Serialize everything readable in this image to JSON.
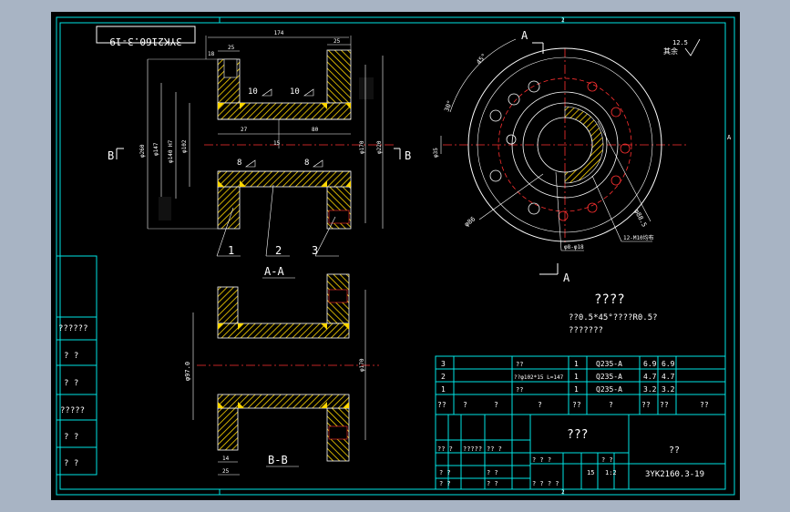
{
  "title_stamp": "3YK2160.3-19",
  "frame": {
    "top_marks": [
      "1",
      "2"
    ],
    "bottom_marks": [
      "1",
      "2"
    ],
    "right_mark": "A",
    "left_cells": [
      "??????",
      "? ?",
      "?????",
      "? ?",
      "? ?",
      "? ?"
    ]
  },
  "section_aa": {
    "label": "A-A",
    "part_numbers": [
      "1",
      "2",
      "3"
    ],
    "arrow_left": "B",
    "arrow_right": "B",
    "dims": {
      "overall": "174",
      "flange_w": "25",
      "flange_w2": "25",
      "step": "18",
      "inner1": "27",
      "inner2": "80",
      "mid": "15",
      "d1": "φ260",
      "d2": "φ147",
      "d3": "φ140 H7",
      "d4": "φ102",
      "d5": "φ170",
      "d6": "φ220"
    },
    "weld": [
      "10",
      "10",
      "8",
      "8"
    ]
  },
  "section_bb": {
    "label": "B-B",
    "dims": {
      "d1": "φ97.0",
      "d2": "φ170",
      "w1": "14",
      "w2": "25"
    }
  },
  "circle_view": {
    "label_top": "A",
    "label_bottom": "A",
    "angles": [
      "45°",
      "30°",
      "15°"
    ],
    "dims": {
      "d1": "φ35",
      "d2": "φ8-φ18",
      "d3": "φ86",
      "d4": "φ88.5"
    },
    "note": "12-M10均布",
    "roughness": "12.5",
    "roughness_note": "其余"
  },
  "notes": {
    "title": "????",
    "line1": "??0.5*45°????R0.5?",
    "line2": "???????"
  },
  "bom": {
    "rows": [
      {
        "no": "3",
        "name": "??",
        "qty": "1",
        "mat": "Q235-A",
        "w1": "6.9",
        "w2": "6.9"
      },
      {
        "no": "2",
        "name": "??φ102*15 L=147",
        "qty": "1",
        "mat": "Q235-A",
        "w1": "4.7",
        "w2": "4.7"
      },
      {
        "no": "1",
        "name": "??",
        "qty": "1",
        "mat": "Q235-A",
        "w1": "3.2",
        "w2": "3.2"
      }
    ],
    "header": [
      "??",
      "?",
      "?",
      "?",
      "??",
      "?",
      "??",
      "??",
      "??"
    ]
  },
  "titleblock": {
    "name": "???",
    "unit": "??",
    "scale": "1:2",
    "sheet": "15",
    "drawing_no": "3YK2160.3-19",
    "labels": [
      "?? ?",
      "?????",
      "?? ?",
      "? ? ?",
      "? ?",
      "? ?",
      "? ?",
      "? ?",
      "? ?",
      "? ? ? ?"
    ]
  }
}
